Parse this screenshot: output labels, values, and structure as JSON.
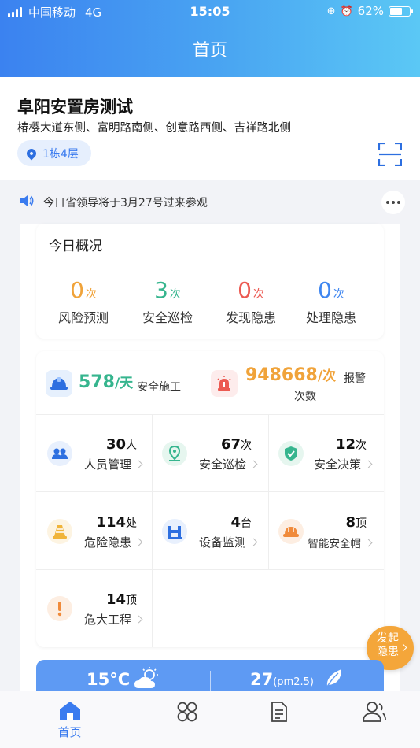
{
  "status_bar": {
    "carrier": "中国移动",
    "network": "4G",
    "time": "15:05",
    "battery": "62%",
    "battery_level": 0.62
  },
  "header": {
    "title": "首页"
  },
  "project": {
    "name": "阜阳安置房测试",
    "address": "椿樱大道东侧、富明路南侧、创意路西侧、吉祥路北侧",
    "location": "1栋4层"
  },
  "notice": {
    "text": "今日省领导将于3月27号过来参观"
  },
  "overview": {
    "title": "今日概况",
    "items": [
      {
        "value": "0",
        "unit": "次",
        "label": "风险预测",
        "color": "#f0a33a"
      },
      {
        "value": "3",
        "unit": "次",
        "label": "安全巡检",
        "color": "#36b58e"
      },
      {
        "value": "0",
        "unit": "次",
        "label": "发现隐患",
        "color": "#ec5a52"
      },
      {
        "value": "0",
        "unit": "次",
        "label": "处理隐患",
        "color": "#3f86f0"
      }
    ]
  },
  "highlights": {
    "construction": {
      "value": "578",
      "unit": "/天",
      "label": "安全施工",
      "color": "#36b58e"
    },
    "alarm": {
      "value": "948668",
      "unit": "/次",
      "label_1": "报警",
      "label_2": "次数",
      "color": "#f0a33a"
    }
  },
  "modules": [
    {
      "value": "30",
      "unit": "人",
      "label": "人员管理",
      "icon": "people-icon"
    },
    {
      "value": "67",
      "unit": "次",
      "label": "安全巡检",
      "icon": "location-pin-icon"
    },
    {
      "value": "12",
      "unit": "次",
      "label": "安全决策",
      "icon": "shield-check-icon"
    },
    {
      "value": "114",
      "unit": "处",
      "label": "危险隐患",
      "icon": "traffic-cone-icon"
    },
    {
      "value": "4",
      "unit": "台",
      "label": "设备监测",
      "icon": "equipment-icon"
    },
    {
      "value": "8",
      "unit": "顶",
      "label": "智能安全帽",
      "icon": "hard-hat-icon"
    },
    {
      "value": "14",
      "unit": "顶",
      "label": "危大工程",
      "icon": "exclamation-icon"
    }
  ],
  "fab": {
    "line1": "发起",
    "line2": "隐患"
  },
  "weather": {
    "temperature": "15°C",
    "pm_value": "27",
    "pm_unit": "(pm2.5)"
  },
  "tabbar": {
    "home_label": "首页"
  }
}
